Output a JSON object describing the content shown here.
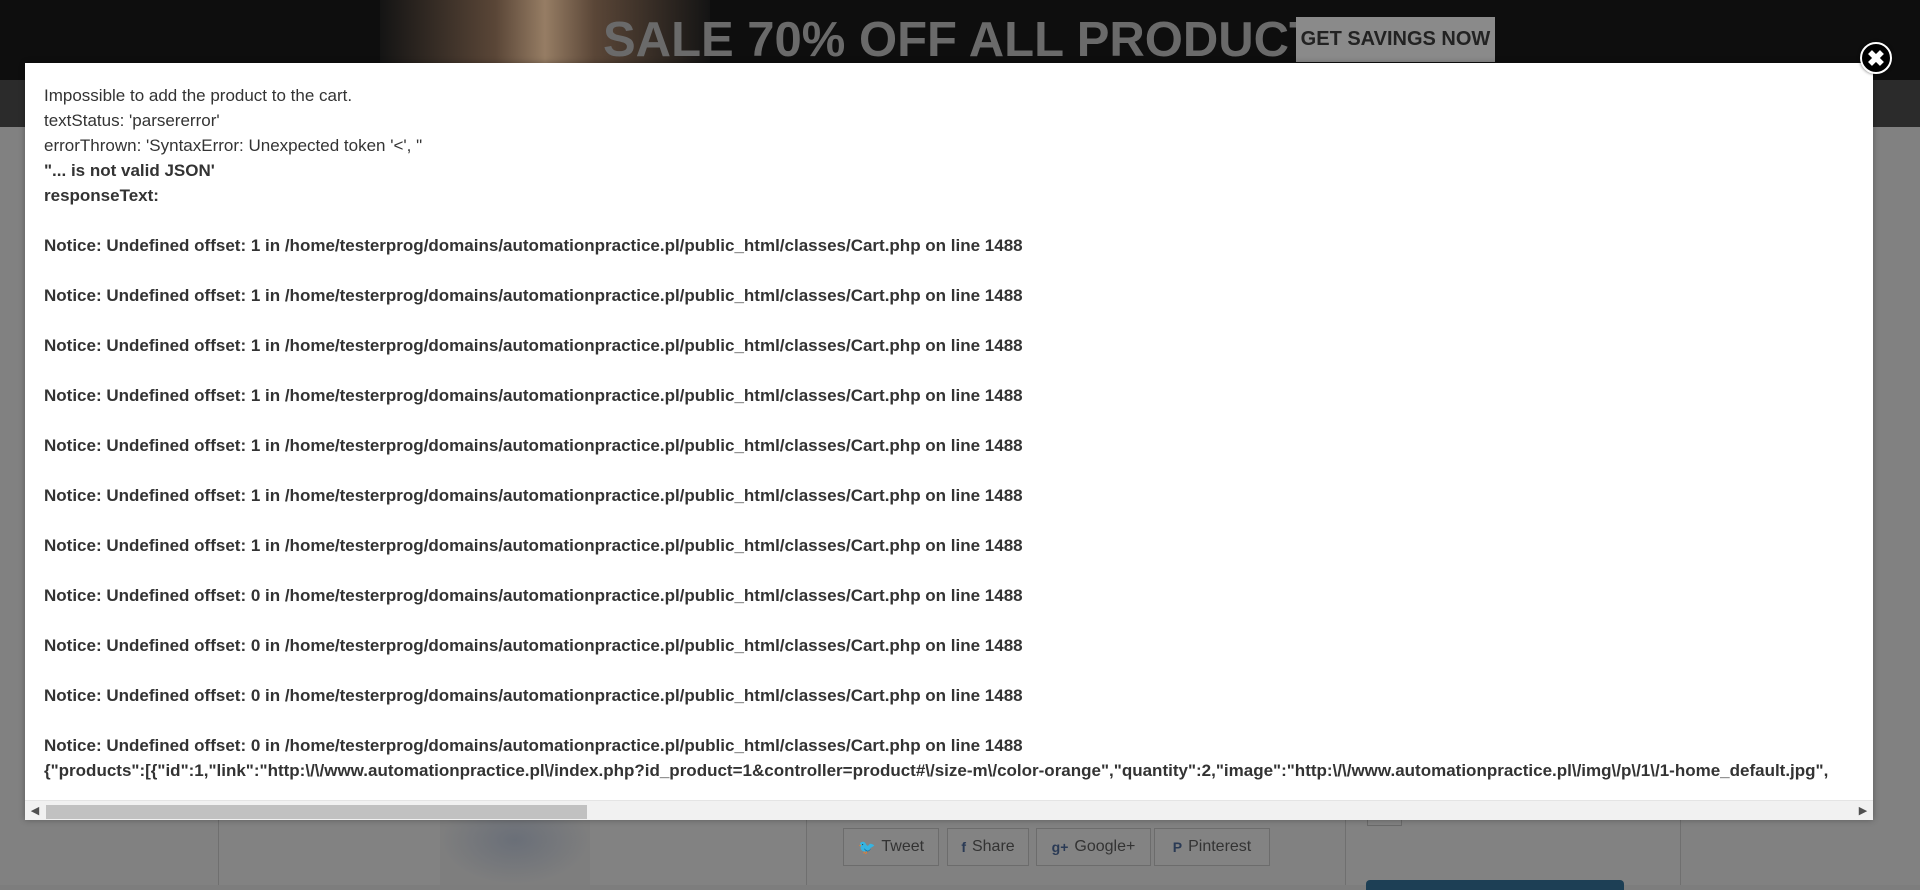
{
  "background": {
    "banner": {
      "headline": "SALE 70% OFF ALL PRODUCTS",
      "button_label": "GET SAVINGS NOW"
    },
    "share_buttons": [
      {
        "icon": "twitter-icon",
        "glyph": "🐦",
        "label": "Tweet"
      },
      {
        "icon": "facebook-icon",
        "glyph": "f",
        "label": "Share"
      },
      {
        "icon": "google-plus-icon",
        "glyph": "g+",
        "label": "Google+"
      },
      {
        "icon": "pinterest-icon",
        "glyph": "P",
        "label": "Pinterest"
      }
    ]
  },
  "modal": {
    "close_symbol": "✖",
    "intro_lines": [
      "Impossible to add the product to the cart.",
      "textStatus: 'parsererror'",
      "errorThrown: 'SyntaxError: Unexpected token '<', \""
    ],
    "bold_lines": [
      "\"... is not valid JSON'",
      "responseText:"
    ],
    "notices": [
      "Notice: Undefined offset: 1 in /home/testerprog/domains/automationpractice.pl/public_html/classes/Cart.php on line 1488",
      "Notice: Undefined offset: 1 in /home/testerprog/domains/automationpractice.pl/public_html/classes/Cart.php on line 1488",
      "Notice: Undefined offset: 1 in /home/testerprog/domains/automationpractice.pl/public_html/classes/Cart.php on line 1488",
      "Notice: Undefined offset: 1 in /home/testerprog/domains/automationpractice.pl/public_html/classes/Cart.php on line 1488",
      "Notice: Undefined offset: 1 in /home/testerprog/domains/automationpractice.pl/public_html/classes/Cart.php on line 1488",
      "Notice: Undefined offset: 1 in /home/testerprog/domains/automationpractice.pl/public_html/classes/Cart.php on line 1488",
      "Notice: Undefined offset: 1 in /home/testerprog/domains/automationpractice.pl/public_html/classes/Cart.php on line 1488",
      "Notice: Undefined offset: 0 in /home/testerprog/domains/automationpractice.pl/public_html/classes/Cart.php on line 1488",
      "Notice: Undefined offset: 0 in /home/testerprog/domains/automationpractice.pl/public_html/classes/Cart.php on line 1488",
      "Notice: Undefined offset: 0 in /home/testerprog/domains/automationpractice.pl/public_html/classes/Cart.php on line 1488",
      "Notice: Undefined offset: 0 in /home/testerprog/domains/automationpractice.pl/public_html/classes/Cart.php on line 1488"
    ],
    "json_line": "{\"products\":[{\"id\":1,\"link\":\"http:\\/\\/www.automationpractice.pl\\/index.php?id_product=1&controller=product#\\/size-m\\/color-orange\",\"quantity\":2,\"image\":\"http:\\/\\/www.automationpractice.pl\\/img\\/p\\/1\\/1-home_default.jpg\",",
    "scrollbar": {
      "left_arrow": "◀",
      "right_arrow": "▶"
    }
  }
}
